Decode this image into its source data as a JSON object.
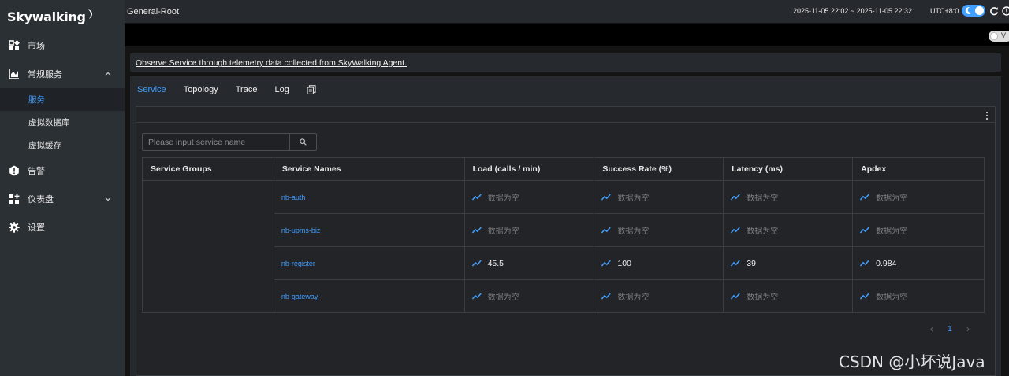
{
  "app": {
    "logo_text": "Skywalking"
  },
  "sidebar": {
    "items": [
      {
        "label": "市场",
        "icon": "marketplace-icon"
      },
      {
        "label": "常规服务",
        "icon": "chart-icon",
        "expanded": true,
        "children": [
          {
            "label": "服务",
            "active": true
          },
          {
            "label": "虚拟数据库"
          },
          {
            "label": "虚拟缓存"
          }
        ]
      },
      {
        "label": "告警",
        "icon": "alarm-icon"
      },
      {
        "label": "仪表盘",
        "icon": "dashboard-icon",
        "expanded": false
      },
      {
        "label": "设置",
        "icon": "gear-icon"
      }
    ]
  },
  "header": {
    "breadcrumb": "General-Root",
    "time_range": "2025-11-05 22:02 ~ 2025-11-05 22:32",
    "timezone": "UTC+8:0"
  },
  "dashbar": {
    "toggle_label": "V"
  },
  "notice": {
    "text": "Observe Service through telemetry data collected from SkyWalking Agent."
  },
  "tabs": [
    {
      "label": "Service",
      "active": true
    },
    {
      "label": "Topology"
    },
    {
      "label": "Trace"
    },
    {
      "label": "Log"
    }
  ],
  "search": {
    "placeholder": "Please input service name"
  },
  "table": {
    "columns": [
      "Service Groups",
      "Service Names",
      "Load (calls / min)",
      "Success Rate (%)",
      "Latency (ms)",
      "Apdex"
    ],
    "rows": [
      {
        "name": "nb-auth",
        "load": "数据为空",
        "success": "数据为空",
        "latency": "数据为空",
        "apdex": "数据为空"
      },
      {
        "name": "nb-upms-biz",
        "load": "数据为空",
        "success": "数据为空",
        "latency": "数据为空",
        "apdex": "数据为空"
      },
      {
        "name": "nb-register",
        "load": "45.5",
        "success": "100",
        "latency": "39",
        "apdex": "0.984"
      },
      {
        "name": "nb-gateway",
        "load": "数据为空",
        "success": "数据为空",
        "latency": "数据为空",
        "apdex": "数据为空"
      }
    ]
  },
  "pagination": {
    "current_page": "1"
  },
  "watermark": "CSDN @小坏说Java",
  "colors": {
    "accent": "#409eff",
    "sidebar_bg": "#2b3035",
    "panel_bg": "#26292d"
  }
}
